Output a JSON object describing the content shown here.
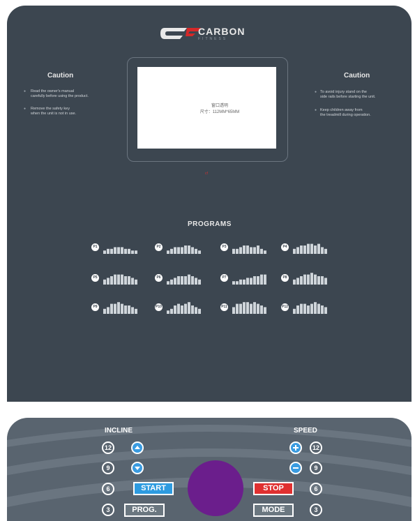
{
  "brand": {
    "name": "CARBON",
    "tagline": "FITNESS"
  },
  "caution_left": {
    "title": "Caution",
    "lines": [
      "Read the owner's manual",
      "carefully before using the product.",
      "Remove the safety key",
      "when the unit is not in use."
    ]
  },
  "caution_right": {
    "title": "Caution",
    "lines": [
      "To avoid injury stand on the",
      "side rails before starting the unit.",
      "Keep children away from",
      "the treadmill during operation."
    ]
  },
  "screen": {
    "line1": "窗口透明",
    "line2": "尺寸：112MM*65MM"
  },
  "mini_logo": "cf",
  "programs": {
    "title": "PROGRAMS",
    "items": [
      "P1",
      "P2",
      "P3",
      "P4",
      "P5",
      "P6",
      "P7",
      "P8",
      "P9",
      "P10",
      "P11",
      "P12"
    ]
  },
  "console": {
    "incline_label": "INCLINE",
    "speed_label": "SPEED",
    "incline_numbers": [
      "12",
      "9",
      "6",
      "3"
    ],
    "speed_numbers": [
      "12",
      "9",
      "6",
      "3"
    ],
    "start_label": "START",
    "prog_label": "PROG.",
    "stop_label": "STOP",
    "mode_label": "MODE"
  },
  "colors": {
    "panel": "#3c4650",
    "console": "#59646f",
    "accent_blue": "#3a9be0",
    "stop_red": "#e03030",
    "knob": "#6b1e8c"
  }
}
